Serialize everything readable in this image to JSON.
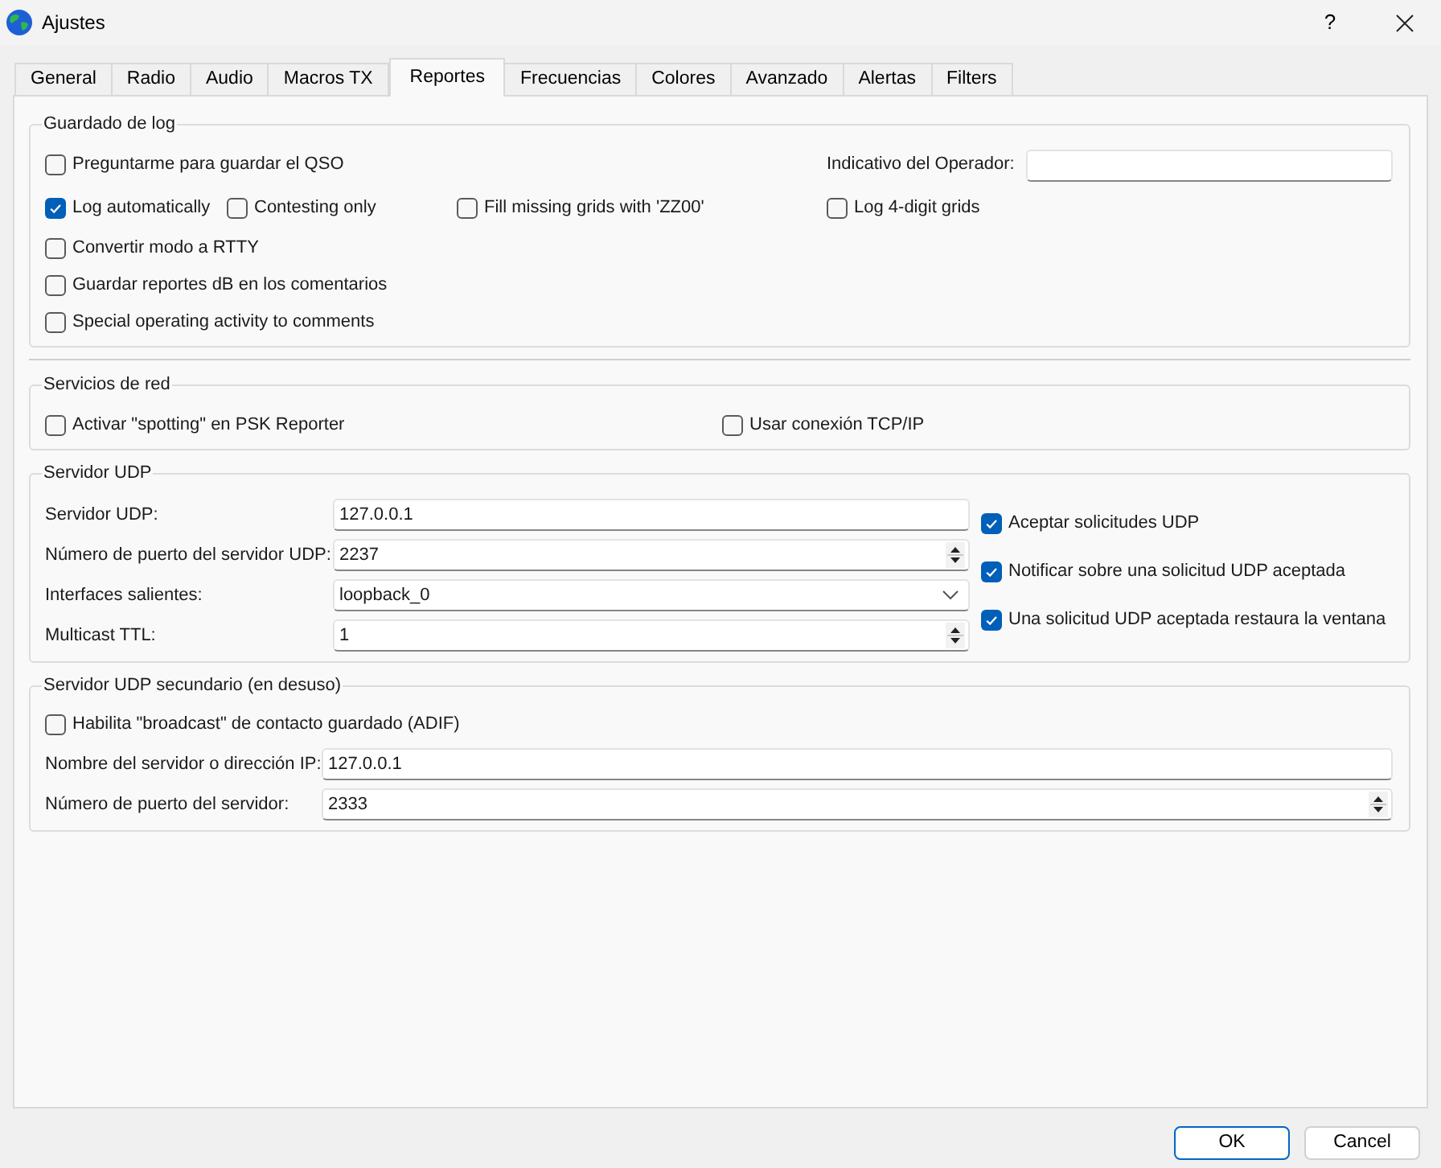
{
  "window": {
    "title": "Ajustes",
    "help": "?"
  },
  "tabs": [
    {
      "label": "General",
      "selected": false
    },
    {
      "label": "Radio",
      "selected": false
    },
    {
      "label": "Audio",
      "selected": false
    },
    {
      "label": "Macros TX",
      "selected": false
    },
    {
      "label": "Reportes",
      "selected": true
    },
    {
      "label": "Frecuencias",
      "selected": false
    },
    {
      "label": "Colores",
      "selected": false
    },
    {
      "label": "Avanzado",
      "selected": false
    },
    {
      "label": "Alertas",
      "selected": false
    },
    {
      "label": "Filters",
      "selected": false
    }
  ],
  "log_saving": {
    "title": "Guardado de log",
    "operator_call": {
      "label": "Indicativo del Operador:"
    },
    "rows": [
      [
        {
          "label": "Preguntarme para guardar el QSO",
          "checked": false
        }
      ],
      [
        {
          "label": "Log automatically",
          "checked": true
        },
        {
          "label": "Contesting only",
          "checked": false
        },
        {
          "label": "Fill missing grids with 'ZZ00'",
          "checked": false
        },
        {
          "label": "Log 4-digit grids",
          "checked": false
        }
      ],
      [
        {
          "label": "Convertir modo a RTTY",
          "checked": false
        }
      ],
      [
        {
          "label": "Guardar reportes dB en los comentarios",
          "checked": false
        }
      ],
      [
        {
          "label": "Special operating activity to comments",
          "checked": false
        }
      ]
    ]
  },
  "network_services": {
    "title": "Servicios de red",
    "options": [
      {
        "label": "Activar \"spotting\" en PSK Reporter",
        "checked": false
      },
      {
        "label": "Usar conexión TCP/IP",
        "checked": false
      }
    ]
  },
  "udp_server": {
    "title": "Servidor UDP",
    "fields": [
      {
        "label": "Servidor UDP:",
        "value": "127.0.0.1",
        "kind": "text"
      },
      {
        "label": "Número de puerto del servidor UDP:",
        "value": "2237",
        "kind": "spin"
      },
      {
        "label": "Interfaces salientes:",
        "value": "loopback_0",
        "kind": "combo"
      },
      {
        "label": "Multicast TTL:",
        "value": "1",
        "kind": "spin"
      }
    ],
    "options": [
      {
        "label": "Aceptar solicitudes UDP",
        "checked": true
      },
      {
        "label": "Notificar sobre una solicitud UDP aceptada",
        "checked": true
      },
      {
        "label": "Una solicitud UDP aceptada restaura la ventana",
        "checked": true
      }
    ]
  },
  "secondary_udp_server": {
    "title": "Servidor UDP secundario (en desuso)",
    "broadcast": {
      "label": "Habilita \"broadcast\" de contacto guardado (ADIF)",
      "checked": false
    },
    "fields": [
      {
        "label": "Nombre del servidor o dirección IP:",
        "value": "127.0.0.1",
        "kind": "text"
      },
      {
        "label": "Número de puerto del servidor:",
        "value": "2333",
        "kind": "spin"
      }
    ]
  },
  "buttons": [
    {
      "label": "OK",
      "default": true
    },
    {
      "label": "Cancel",
      "default": false
    }
  ]
}
